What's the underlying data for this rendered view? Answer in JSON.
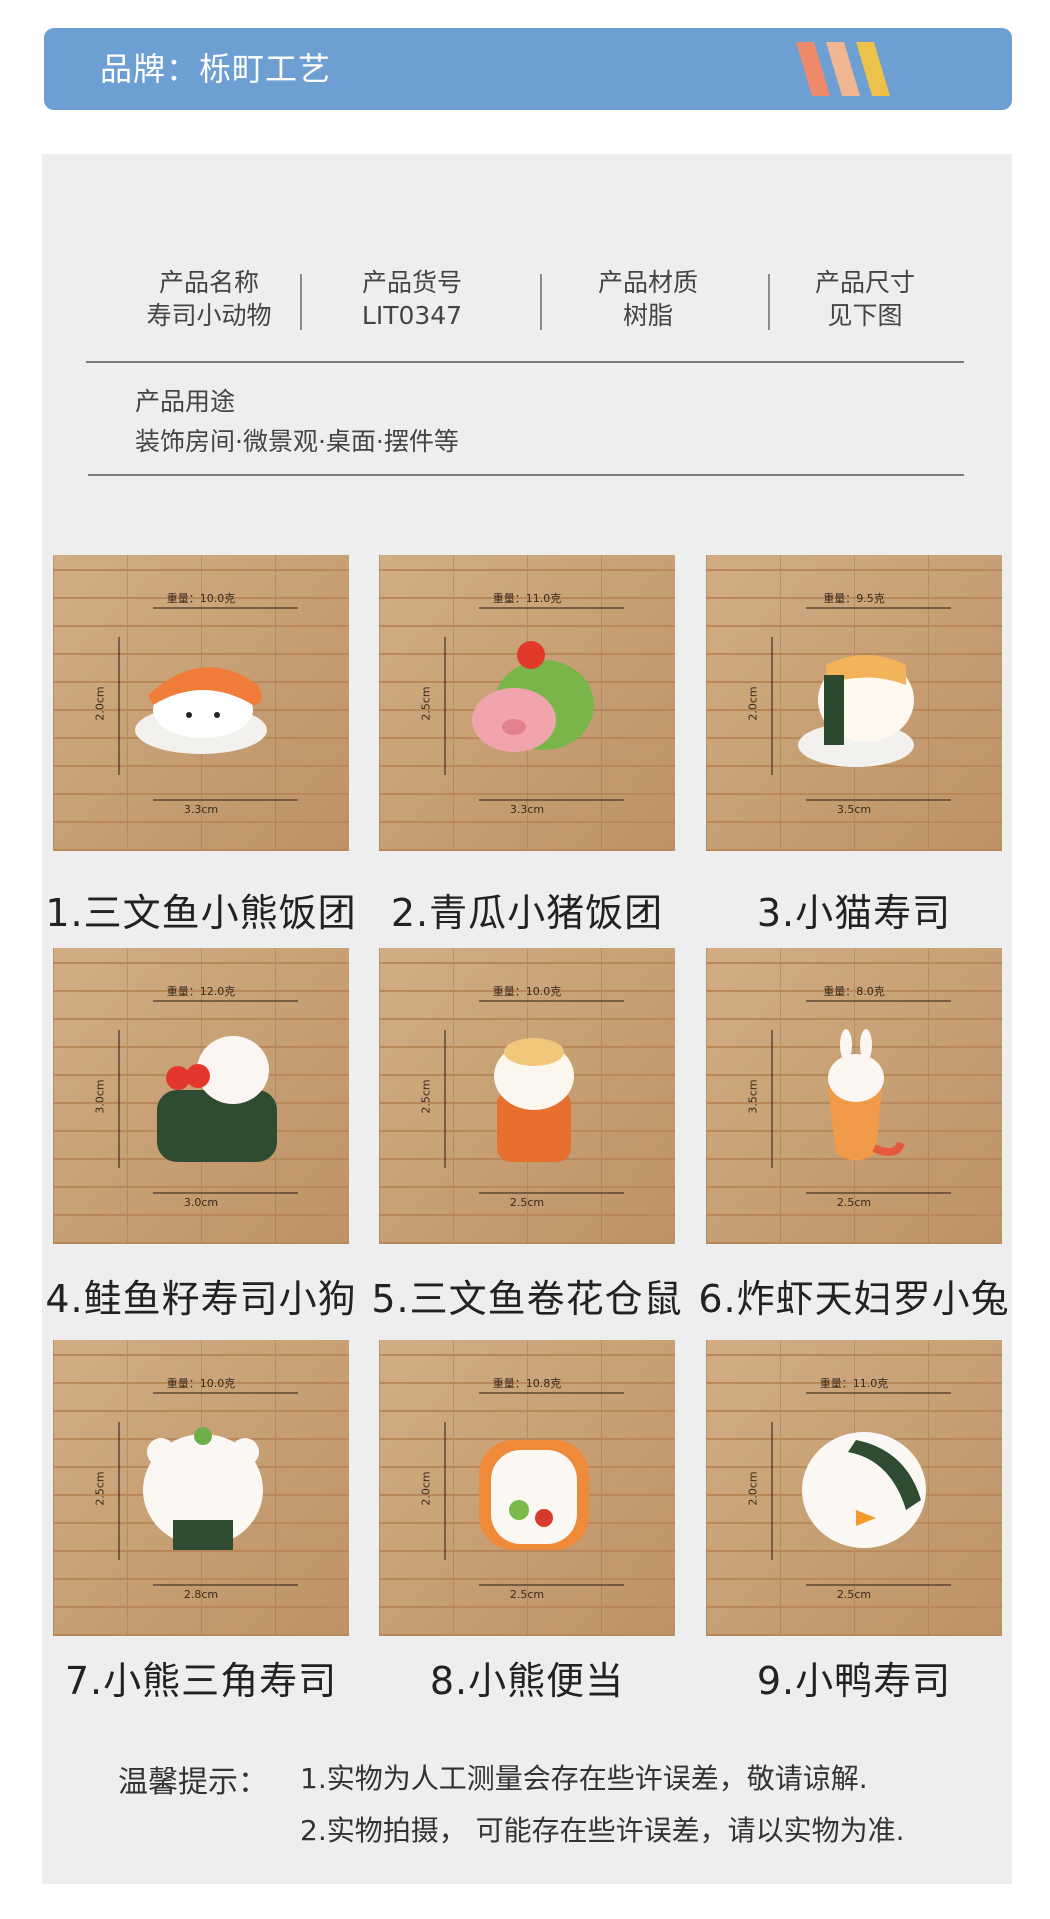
{
  "brand": {
    "label": "品牌：栎町工艺",
    "stripe_colors": [
      "#ee8a6a",
      "#f0b692",
      "#ecc24a"
    ]
  },
  "specs": [
    {
      "title": "产品名称",
      "value": "寿司小动物"
    },
    {
      "title": "产品货号",
      "value": "LIT0347"
    },
    {
      "title": "产品材质",
      "value": "树脂"
    },
    {
      "title": "产品尺寸",
      "value": "见下图"
    }
  ],
  "usage": {
    "title": "产品用途",
    "text": "装饰房间·微景观·桌面·摆件等"
  },
  "products": [
    {
      "caption": "1.三文鱼小熊饭团",
      "weight": "重量：10.0克",
      "height": "2.0cm",
      "width": "3.3cm",
      "icon": "salmon-bear-sushi-icon"
    },
    {
      "caption": "2.青瓜小猪饭团",
      "weight": "重量：11.0克",
      "height": "2.5cm",
      "width": "3.3cm",
      "icon": "cucumber-pig-sushi-icon"
    },
    {
      "caption": "3.小猫寿司",
      "weight": "重量：9.5克",
      "height": "2.0cm",
      "width": "3.5cm",
      "icon": "cat-sushi-icon"
    },
    {
      "caption": "4.鲑鱼籽寿司小狗",
      "weight": "重量：12.0克",
      "height": "3.0cm",
      "width": "3.0cm",
      "icon": "roe-dog-sushi-icon"
    },
    {
      "caption": "5.三文鱼卷花仓鼠",
      "weight": "重量：10.0克",
      "height": "2.5cm",
      "width": "2.5cm",
      "icon": "salmon-roll-hamster-icon"
    },
    {
      "caption": "6.炸虾天妇罗小兔",
      "weight": "重量：8.0克",
      "height": "3.5cm",
      "width": "2.5cm",
      "icon": "tempura-rabbit-icon"
    },
    {
      "caption": "7.小熊三角寿司",
      "weight": "重量：10.0克",
      "height": "2.5cm",
      "width": "2.8cm",
      "icon": "onigiri-bear-icon"
    },
    {
      "caption": "8.小熊便当",
      "weight": "重量：10.8克",
      "height": "2.0cm",
      "width": "2.5cm",
      "icon": "bento-bear-icon"
    },
    {
      "caption": "9.小鸭寿司",
      "weight": "重量：11.0克",
      "height": "2.0cm",
      "width": "2.5cm",
      "icon": "duck-sushi-icon"
    }
  ],
  "tips": {
    "label": "温馨提示：",
    "line1": "1.实物为人工测量会存在些许误差，敬请谅解.",
    "line2": "2.实物拍摄，  可能存在些许误差，请以实物为准."
  }
}
